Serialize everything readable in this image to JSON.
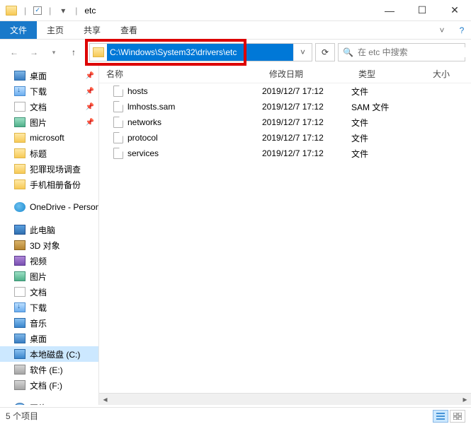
{
  "window": {
    "title": "etc"
  },
  "ribbon": {
    "file": "文件",
    "tabs": [
      "主页",
      "共享",
      "查看"
    ]
  },
  "address": {
    "path": "C:\\Windows\\System32\\drivers\\etc",
    "search_placeholder": "在 etc 中搜索"
  },
  "columns": {
    "name": "名称",
    "date": "修改日期",
    "type": "类型",
    "size": "大小"
  },
  "files": [
    {
      "name": "hosts",
      "date": "2019/12/7 17:12",
      "type": "文件"
    },
    {
      "name": "lmhosts.sam",
      "date": "2019/12/7 17:12",
      "type": "SAM 文件"
    },
    {
      "name": "networks",
      "date": "2019/12/7 17:12",
      "type": "文件"
    },
    {
      "name": "protocol",
      "date": "2019/12/7 17:12",
      "type": "文件"
    },
    {
      "name": "services",
      "date": "2019/12/7 17:12",
      "type": "文件"
    }
  ],
  "sidebar": [
    {
      "label": "桌面",
      "icon": "desktop",
      "pin": true
    },
    {
      "label": "下载",
      "icon": "download",
      "pin": true
    },
    {
      "label": "文档",
      "icon": "doc",
      "pin": true
    },
    {
      "label": "图片",
      "icon": "pic",
      "pin": true
    },
    {
      "label": "microsoft",
      "icon": "folder"
    },
    {
      "label": "标题",
      "icon": "folder"
    },
    {
      "label": "犯罪现场调查",
      "icon": "folder"
    },
    {
      "label": "手机相册备份",
      "icon": "folder"
    },
    {
      "spacer": true
    },
    {
      "label": "OneDrive - Personal",
      "icon": "cloud"
    },
    {
      "spacer": true
    },
    {
      "label": "此电脑",
      "icon": "pc"
    },
    {
      "label": "3D 对象",
      "icon": "cube"
    },
    {
      "label": "视频",
      "icon": "video"
    },
    {
      "label": "图片",
      "icon": "pic"
    },
    {
      "label": "文档",
      "icon": "doc"
    },
    {
      "label": "下载",
      "icon": "download"
    },
    {
      "label": "音乐",
      "icon": "music"
    },
    {
      "label": "桌面",
      "icon": "desktop"
    },
    {
      "label": "本地磁盘 (C:)",
      "icon": "drivec",
      "selected": true
    },
    {
      "label": "软件 (E:)",
      "icon": "drive"
    },
    {
      "label": "文档 (F:)",
      "icon": "drive"
    },
    {
      "spacer": true
    },
    {
      "label": "网络",
      "icon": "net"
    }
  ],
  "status": {
    "count": "5 个项目"
  }
}
